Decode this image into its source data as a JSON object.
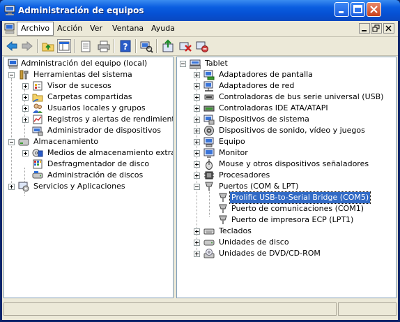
{
  "window": {
    "title": "Administración de equipos"
  },
  "menu": {
    "items": [
      "Archivo",
      "Acción",
      "Ver",
      "Ventana",
      "Ayuda"
    ]
  },
  "toolbar": {
    "icons": [
      "back-arrow",
      "forward-arrow",
      "up-folder",
      "show-hide-tree",
      "properties",
      "print",
      "help",
      "scan-hardware",
      "update-driver",
      "uninstall-device",
      "disable-device"
    ]
  },
  "left_tree": {
    "root": "Administración del equipo (local)",
    "nodes": [
      {
        "label": "Herramientas del sistema"
      },
      {
        "label": "Visor de sucesos"
      },
      {
        "label": "Carpetas compartidas"
      },
      {
        "label": "Usuarios locales y grupos"
      },
      {
        "label": "Registros y alertas de rendimiento"
      },
      {
        "label": "Administrador de dispositivos"
      },
      {
        "label": "Almacenamiento"
      },
      {
        "label": "Medios de almacenamiento extraíbles"
      },
      {
        "label": "Desfragmentador de disco"
      },
      {
        "label": "Administración de discos"
      },
      {
        "label": "Servicios y Aplicaciones"
      }
    ]
  },
  "right_tree": {
    "root": "Tablet",
    "nodes": [
      {
        "label": "Adaptadores de pantalla"
      },
      {
        "label": "Adaptadores de red"
      },
      {
        "label": "Controladoras de bus serie universal (USB)"
      },
      {
        "label": "Controladoras IDE ATA/ATAPI"
      },
      {
        "label": "Dispositivos de sistema"
      },
      {
        "label": "Dispositivos de sonido, vídeo y juegos"
      },
      {
        "label": "Equipo"
      },
      {
        "label": "Monitor"
      },
      {
        "label": "Mouse y otros dispositivos señaladores"
      },
      {
        "label": "Procesadores"
      },
      {
        "label": "Puertos (COM & LPT)"
      },
      {
        "label": "Prolific USB-to-Serial Bridge (COM5)"
      },
      {
        "label": "Puerto de comunicaciones (COM1)"
      },
      {
        "label": "Puerto de impresora ECP (LPT1)"
      },
      {
        "label": "Teclados"
      },
      {
        "label": "Unidades de disco"
      },
      {
        "label": "Unidades de DVD/CD-ROM"
      }
    ]
  },
  "colors": {
    "titlebar": "#0a5de0",
    "selection": "#316ac5",
    "face": "#ece9d8"
  }
}
